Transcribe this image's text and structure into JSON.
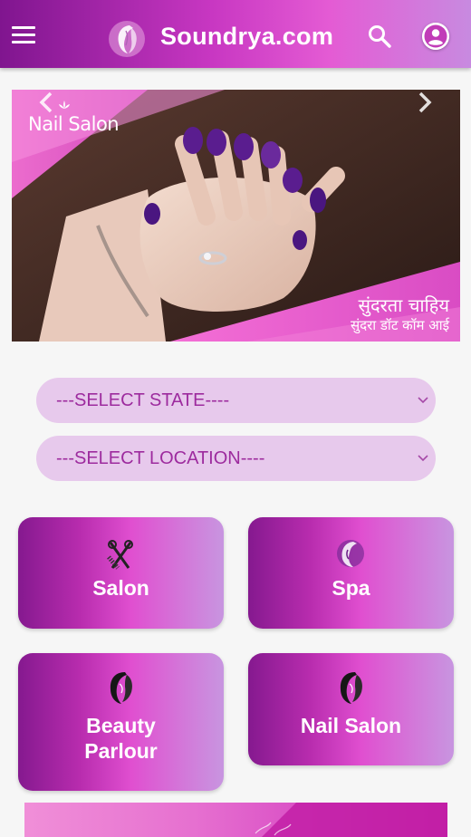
{
  "header": {
    "brand": "Soundrya.com",
    "menu_icon": "hamburger-menu-icon",
    "logo_icon": "woman-profile-logo-icon",
    "search_icon": "search-icon",
    "account_icon": "account-circle-icon"
  },
  "banner": {
    "brand": "Nail Salon",
    "tagline": "सुंदरता चाहिय",
    "subline": "सुंदरा डॉट कॉम आई",
    "prev_icon": "chevron-left-icon",
    "next_icon": "chevron-right-icon"
  },
  "filters": {
    "state": "---SELECT STATE----",
    "location": "---SELECT LOCATION----"
  },
  "categories": [
    {
      "label": "Salon",
      "icon": "scissors-comb-icon"
    },
    {
      "label": "Spa",
      "icon": "spa-face-icon"
    },
    {
      "label": "Beauty\nParlour",
      "icon": "woman-face-icon"
    },
    {
      "label": "Nail Salon",
      "icon": "woman-face-icon"
    }
  ],
  "colors": {
    "accent": "#c837c2",
    "select_bg": "#e7c9ec",
    "select_text": "#9d2b9e"
  }
}
